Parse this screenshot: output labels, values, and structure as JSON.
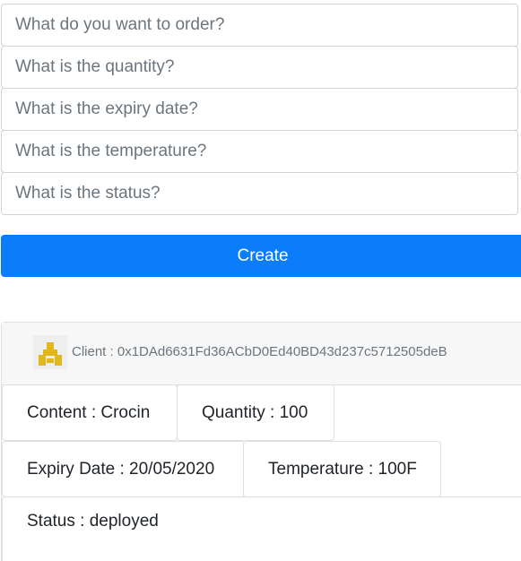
{
  "form": {
    "order_placeholder": "What do you want to order?",
    "quantity_placeholder": "What is the quantity?",
    "expiry_placeholder": "What is the expiry date?",
    "temperature_placeholder": "What is the temperature?",
    "status_placeholder": "What is the status?",
    "create_label": "Create"
  },
  "card": {
    "client": "Client : 0x1DAd6631Fd36ACbD0Ed40BD43d237c5712505deB",
    "avatar_icon": "identicon",
    "avatar_color": "#e2b719",
    "content": "Content : Crocin",
    "quantity": "Quantity : 100",
    "expiry": "Expiry Date : 20/05/2020",
    "temperature": "Temperature : 100F",
    "status": "Status : deployed"
  }
}
